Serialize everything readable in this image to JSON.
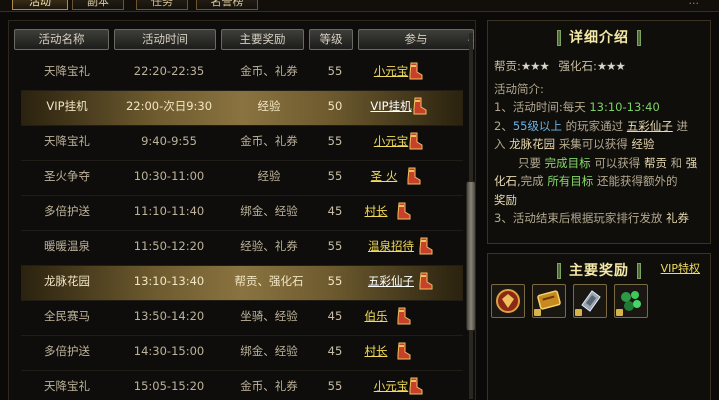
{
  "top_tabs": [
    {
      "label": "活动",
      "active": true
    },
    {
      "label": "副本",
      "active": false
    },
    {
      "label": "任务",
      "active": false
    },
    {
      "label": "名誉榜",
      "active": false
    }
  ],
  "top_right": "...",
  "table": {
    "headers": [
      "活动名称",
      "活动时间",
      "主要奖励",
      "等级",
      "参与"
    ],
    "rows": [
      {
        "name": "天降宝礼",
        "time": "22:20-22:35",
        "reward": "金币、礼券",
        "level": "55",
        "npc": "小元宝",
        "highlight": false
      },
      {
        "name": "VIP挂机",
        "time": "22:00-次日9:30",
        "reward": "经验",
        "level": "50",
        "npc": "VIP挂机",
        "highlight": true
      },
      {
        "name": "天降宝礼",
        "time": "9:40-9:55",
        "reward": "金币、礼券",
        "level": "55",
        "npc": "小元宝",
        "highlight": false
      },
      {
        "name": "圣火争夺",
        "time": "10:30-11:00",
        "reward": "经验",
        "level": "55",
        "npc": "圣 火",
        "highlight": false
      },
      {
        "name": "多倍护送",
        "time": "11:10-11:40",
        "reward": "绑金、经验",
        "level": "45",
        "npc": "村长",
        "highlight": false
      },
      {
        "name": "暖暖温泉",
        "time": "11:50-12:20",
        "reward": "经验、礼券",
        "level": "55",
        "npc": "温泉招待",
        "highlight": false
      },
      {
        "name": "龙脉花园",
        "time": "13:10-13:40",
        "reward": "帮贡、强化石",
        "level": "55",
        "npc": "五彩仙子",
        "highlight": true
      },
      {
        "name": "全民赛马",
        "time": "13:50-14:20",
        "reward": "坐骑、经验",
        "level": "45",
        "npc": "伯乐",
        "highlight": false
      },
      {
        "name": "多倍护送",
        "time": "14:30-15:00",
        "reward": "绑金、经验",
        "level": "45",
        "npc": "村长",
        "highlight": false
      },
      {
        "name": "天降宝礼",
        "time": "15:05-15:20",
        "reward": "金币、礼券",
        "level": "55",
        "npc": "小元宝",
        "highlight": false
      }
    ]
  },
  "detail": {
    "title": "详细介绍",
    "bang_label": "帮贡:",
    "bang_stars": "★★★",
    "qiang_label": "强化石:",
    "qiang_stars": "★★★",
    "intro_label": "活动简介:",
    "l1_prefix": "1、活动时间:每天",
    "l1_time": "13:10-13:40",
    "l2_prefix": "2、",
    "l2_level": "55级以上",
    "l2_mid": "的玩家通过",
    "l2_npc": "五彩仙子",
    "l2_end": "进",
    "l3_pre": "入",
    "l3_place": "龙脉花园",
    "l3_mid": "采集可以获得",
    "l3_exp": "经验",
    "l4_pre": "只要",
    "l4_goal": "完成目标",
    "l4_mid": "可以获得",
    "l4_bang": "帮贡",
    "l4_and": "和",
    "l4_strong": "强",
    "l5_a": "化石",
    "l5_b": ",完成",
    "l5_all": "所有目标",
    "l5_c": "还能获得额外的",
    "l6": "奖励",
    "l7_pre": "3、活动结束后根据玩家排行发放",
    "l7_gift": "礼券"
  },
  "rewards": {
    "title": "主要奖励",
    "vip_link": "VIP特权",
    "icons": [
      "medal-icon",
      "gold-ticket-icon",
      "silver-crystal-icon",
      "green-gem-icon"
    ]
  },
  "colors": {
    "link_yellow": "#f0dc5a",
    "time_green": "#7fd068",
    "level_blue": "#69b3e6",
    "highlight_gold": "#8a7340"
  }
}
